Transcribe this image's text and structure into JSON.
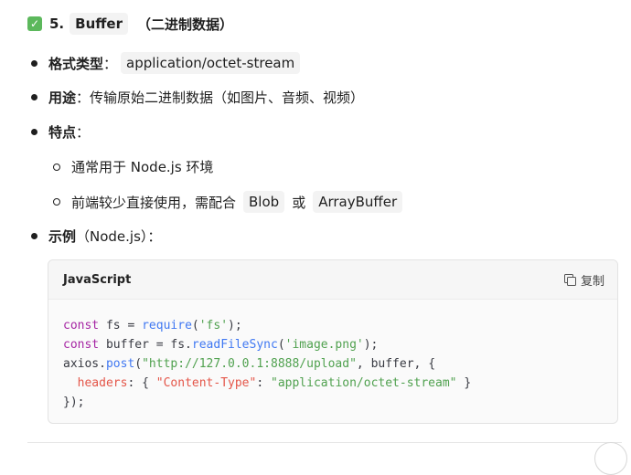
{
  "heading": {
    "number": "5.",
    "name": "Buffer",
    "suffix": "（二进制数据）"
  },
  "items": {
    "format": {
      "label": "格式类型",
      "sep": "：",
      "value": "application/octet-stream"
    },
    "usage": {
      "label": "用途",
      "text": "：传输原始二进制数据（如图片、音频、视频）"
    },
    "features": {
      "label": "特点",
      "sep": "：",
      "sub1": "通常用于 Node.js 环境",
      "sub2_pre": "前端较少直接使用，需配合",
      "sub2_chip1": "Blob",
      "sub2_mid": "或",
      "sub2_chip2": "ArrayBuffer"
    },
    "example": {
      "label": "示例",
      "text": "（Node.js）："
    }
  },
  "code": {
    "language": "JavaScript",
    "copy_label": "复制",
    "line1": {
      "kw": "const",
      "a": " fs = ",
      "fn": "require",
      "b": "(",
      "s": "'fs'",
      "c": ");"
    },
    "line2": {
      "kw": "const",
      "a": " buffer = fs.",
      "fn": "readFileSync",
      "b": "(",
      "s": "'image.png'",
      "c": ");"
    },
    "line3": {
      "a": "axios.",
      "fn": "post",
      "b": "(",
      "s": "\"http://127.0.0.1:8888/upload\"",
      "c": ", buffer, {"
    },
    "line4": {
      "indent": "  ",
      "prop": "headers",
      "a": ": { ",
      "k": "\"Content-Type\"",
      "b": ": ",
      "v": "\"application/octet-stream\"",
      "c": " }"
    },
    "line5": "});"
  }
}
